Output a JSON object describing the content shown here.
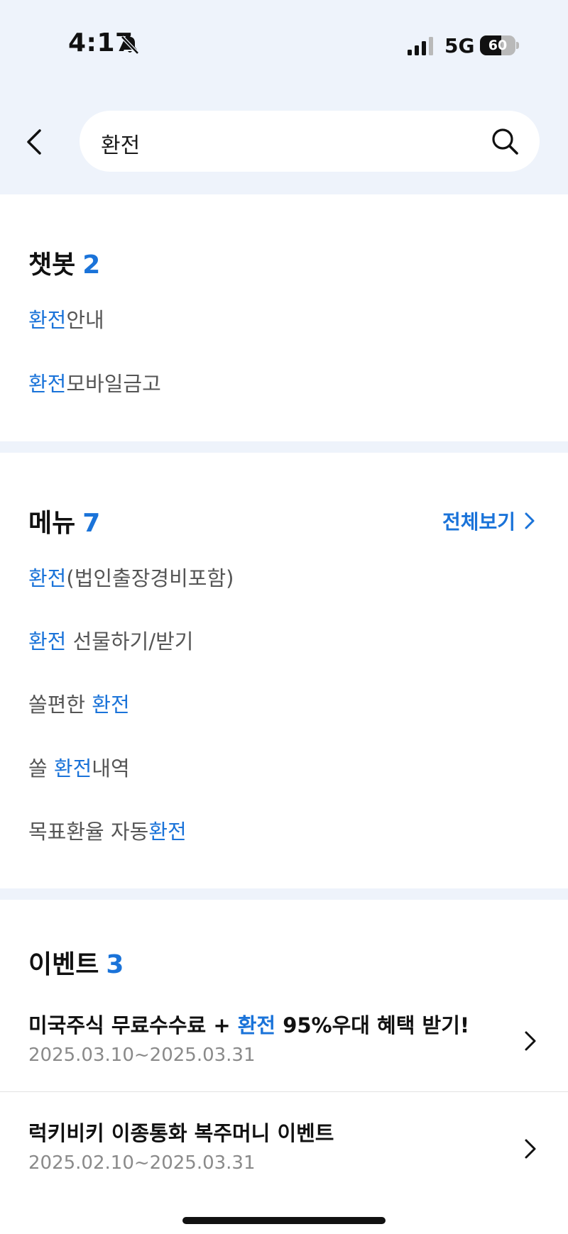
{
  "status_bar": {
    "time": "4:17",
    "network": "5G",
    "battery_level": "60",
    "battery_percent": 60
  },
  "search": {
    "query": "환전",
    "placeholder": ""
  },
  "chatbot": {
    "title": "챗봇",
    "count": "2",
    "items": [
      {
        "highlight": "환전",
        "suffix": "안내"
      },
      {
        "highlight": "환전",
        "suffix": "모바일금고"
      }
    ]
  },
  "menu": {
    "title": "메뉴",
    "count": "7",
    "view_all": "전체보기",
    "items": [
      {
        "prefix": "",
        "highlight": "환전",
        "suffix": "(법인출장경비포함)"
      },
      {
        "prefix": "",
        "highlight": "환전",
        "suffix": " 선물하기/받기"
      },
      {
        "prefix": "쏠편한 ",
        "highlight": "환전",
        "suffix": ""
      },
      {
        "prefix": "쏠 ",
        "highlight": "환전",
        "suffix": "내역"
      },
      {
        "prefix": "목표환율 자동",
        "highlight": "환전",
        "suffix": ""
      }
    ]
  },
  "events": {
    "title": "이벤트",
    "count": "3",
    "items": [
      {
        "prefix": "미국주식 무료수수료 + ",
        "highlight": "환전",
        "suffix": " 95%우대 혜택 받기!",
        "date": "2025.03.10~2025.03.31"
      },
      {
        "prefix": "럭키비키 이종통화 복주머니 이벤트",
        "highlight": "",
        "suffix": "",
        "date": "2025.02.10~2025.03.31"
      }
    ]
  },
  "colors": {
    "accent": "#1a73d9",
    "background_top": "#eef3fb",
    "text": "#111111",
    "muted": "#8a8a8a"
  }
}
